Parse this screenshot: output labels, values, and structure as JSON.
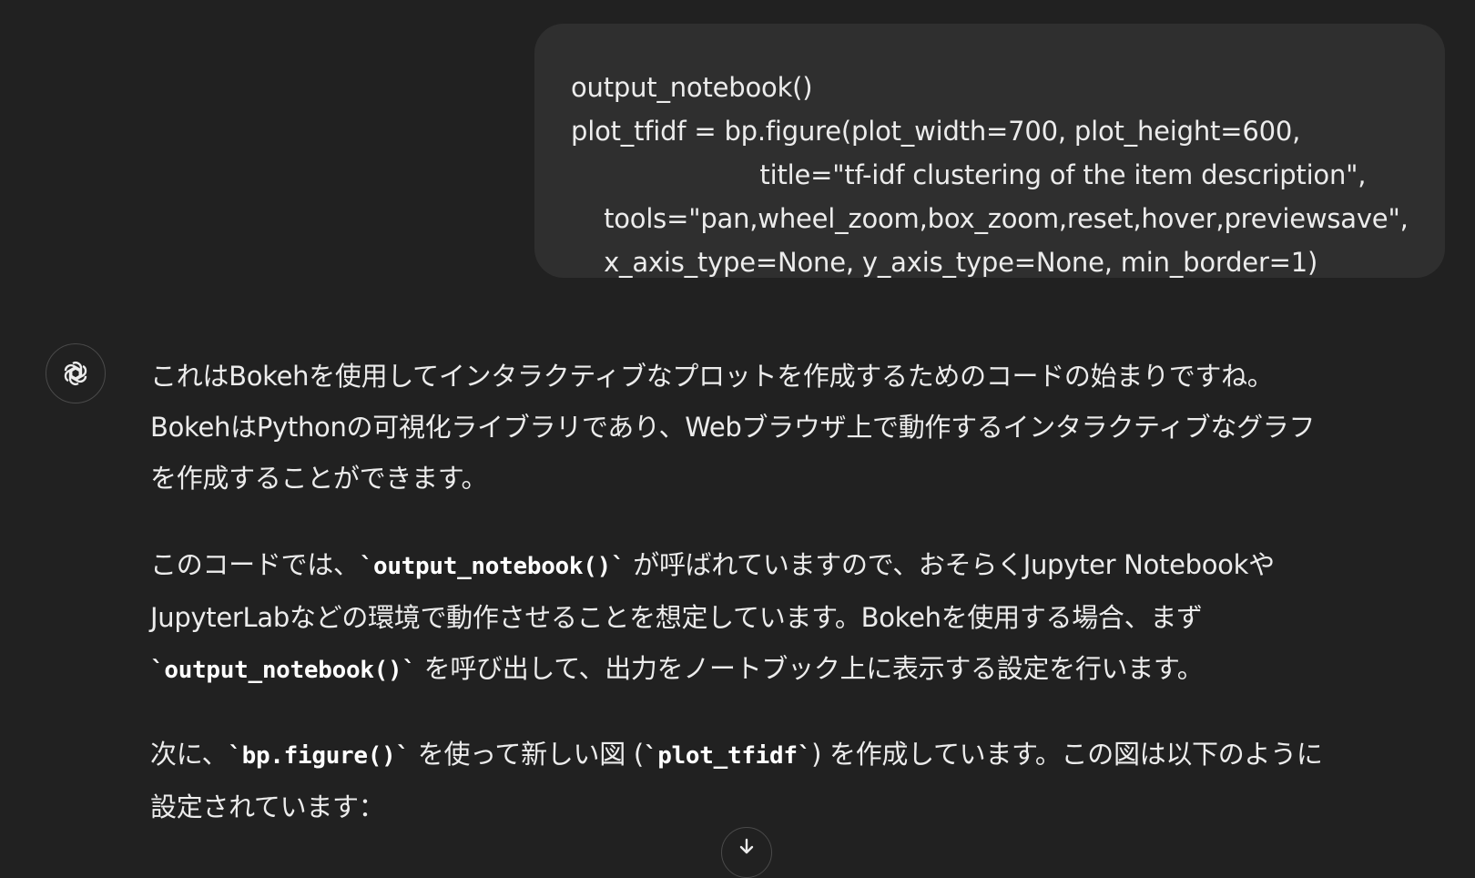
{
  "user_message": {
    "lines": [
      "output_notebook()",
      "plot_tfidf = bp.figure(plot_width=700, plot_height=600,",
      "                       title=\"tf-idf clustering of the item description\",",
      "    tools=\"pan,wheel_zoom,box_zoom,reset,hover,previewsave\",",
      "    x_axis_type=None, y_axis_type=None, min_border=1)"
    ]
  },
  "assistant": {
    "avatar_icon": "openai-logo-icon",
    "p1_lines": [
      "これはBokehを使用してインタラクティブなプロットを作成するためのコードの始まりですね。",
      "BokehはPythonの可視化ライブラリであり、Webブラウザ上で動作するインタラクティブなグラフ",
      "を作成することができます。"
    ],
    "p2": {
      "l1_pre": "このコードでは、",
      "l1_code": "`output_notebook()`",
      "l1_post": " が呼ばれていますので、おそらくJupyter Notebookや",
      "l2": "JupyterLabなどの環境で動作させることを想定しています。Bokehを使用する場合、まず",
      "l3_code": "`output_notebook()`",
      "l3_post": " を呼び出して、出力をノートブック上に表示する設定を行います。"
    },
    "p3": {
      "l1_pre": "次に、",
      "l1_code1": "`bp.figure()`",
      "l1_mid": " を使って新しい図 (",
      "l1_code2": "`plot_tfidf`",
      "l1_post": ") を作成しています。この図は以下のように",
      "l2": "設定されています："
    }
  },
  "scroll_down_icon": "arrow-down-icon"
}
